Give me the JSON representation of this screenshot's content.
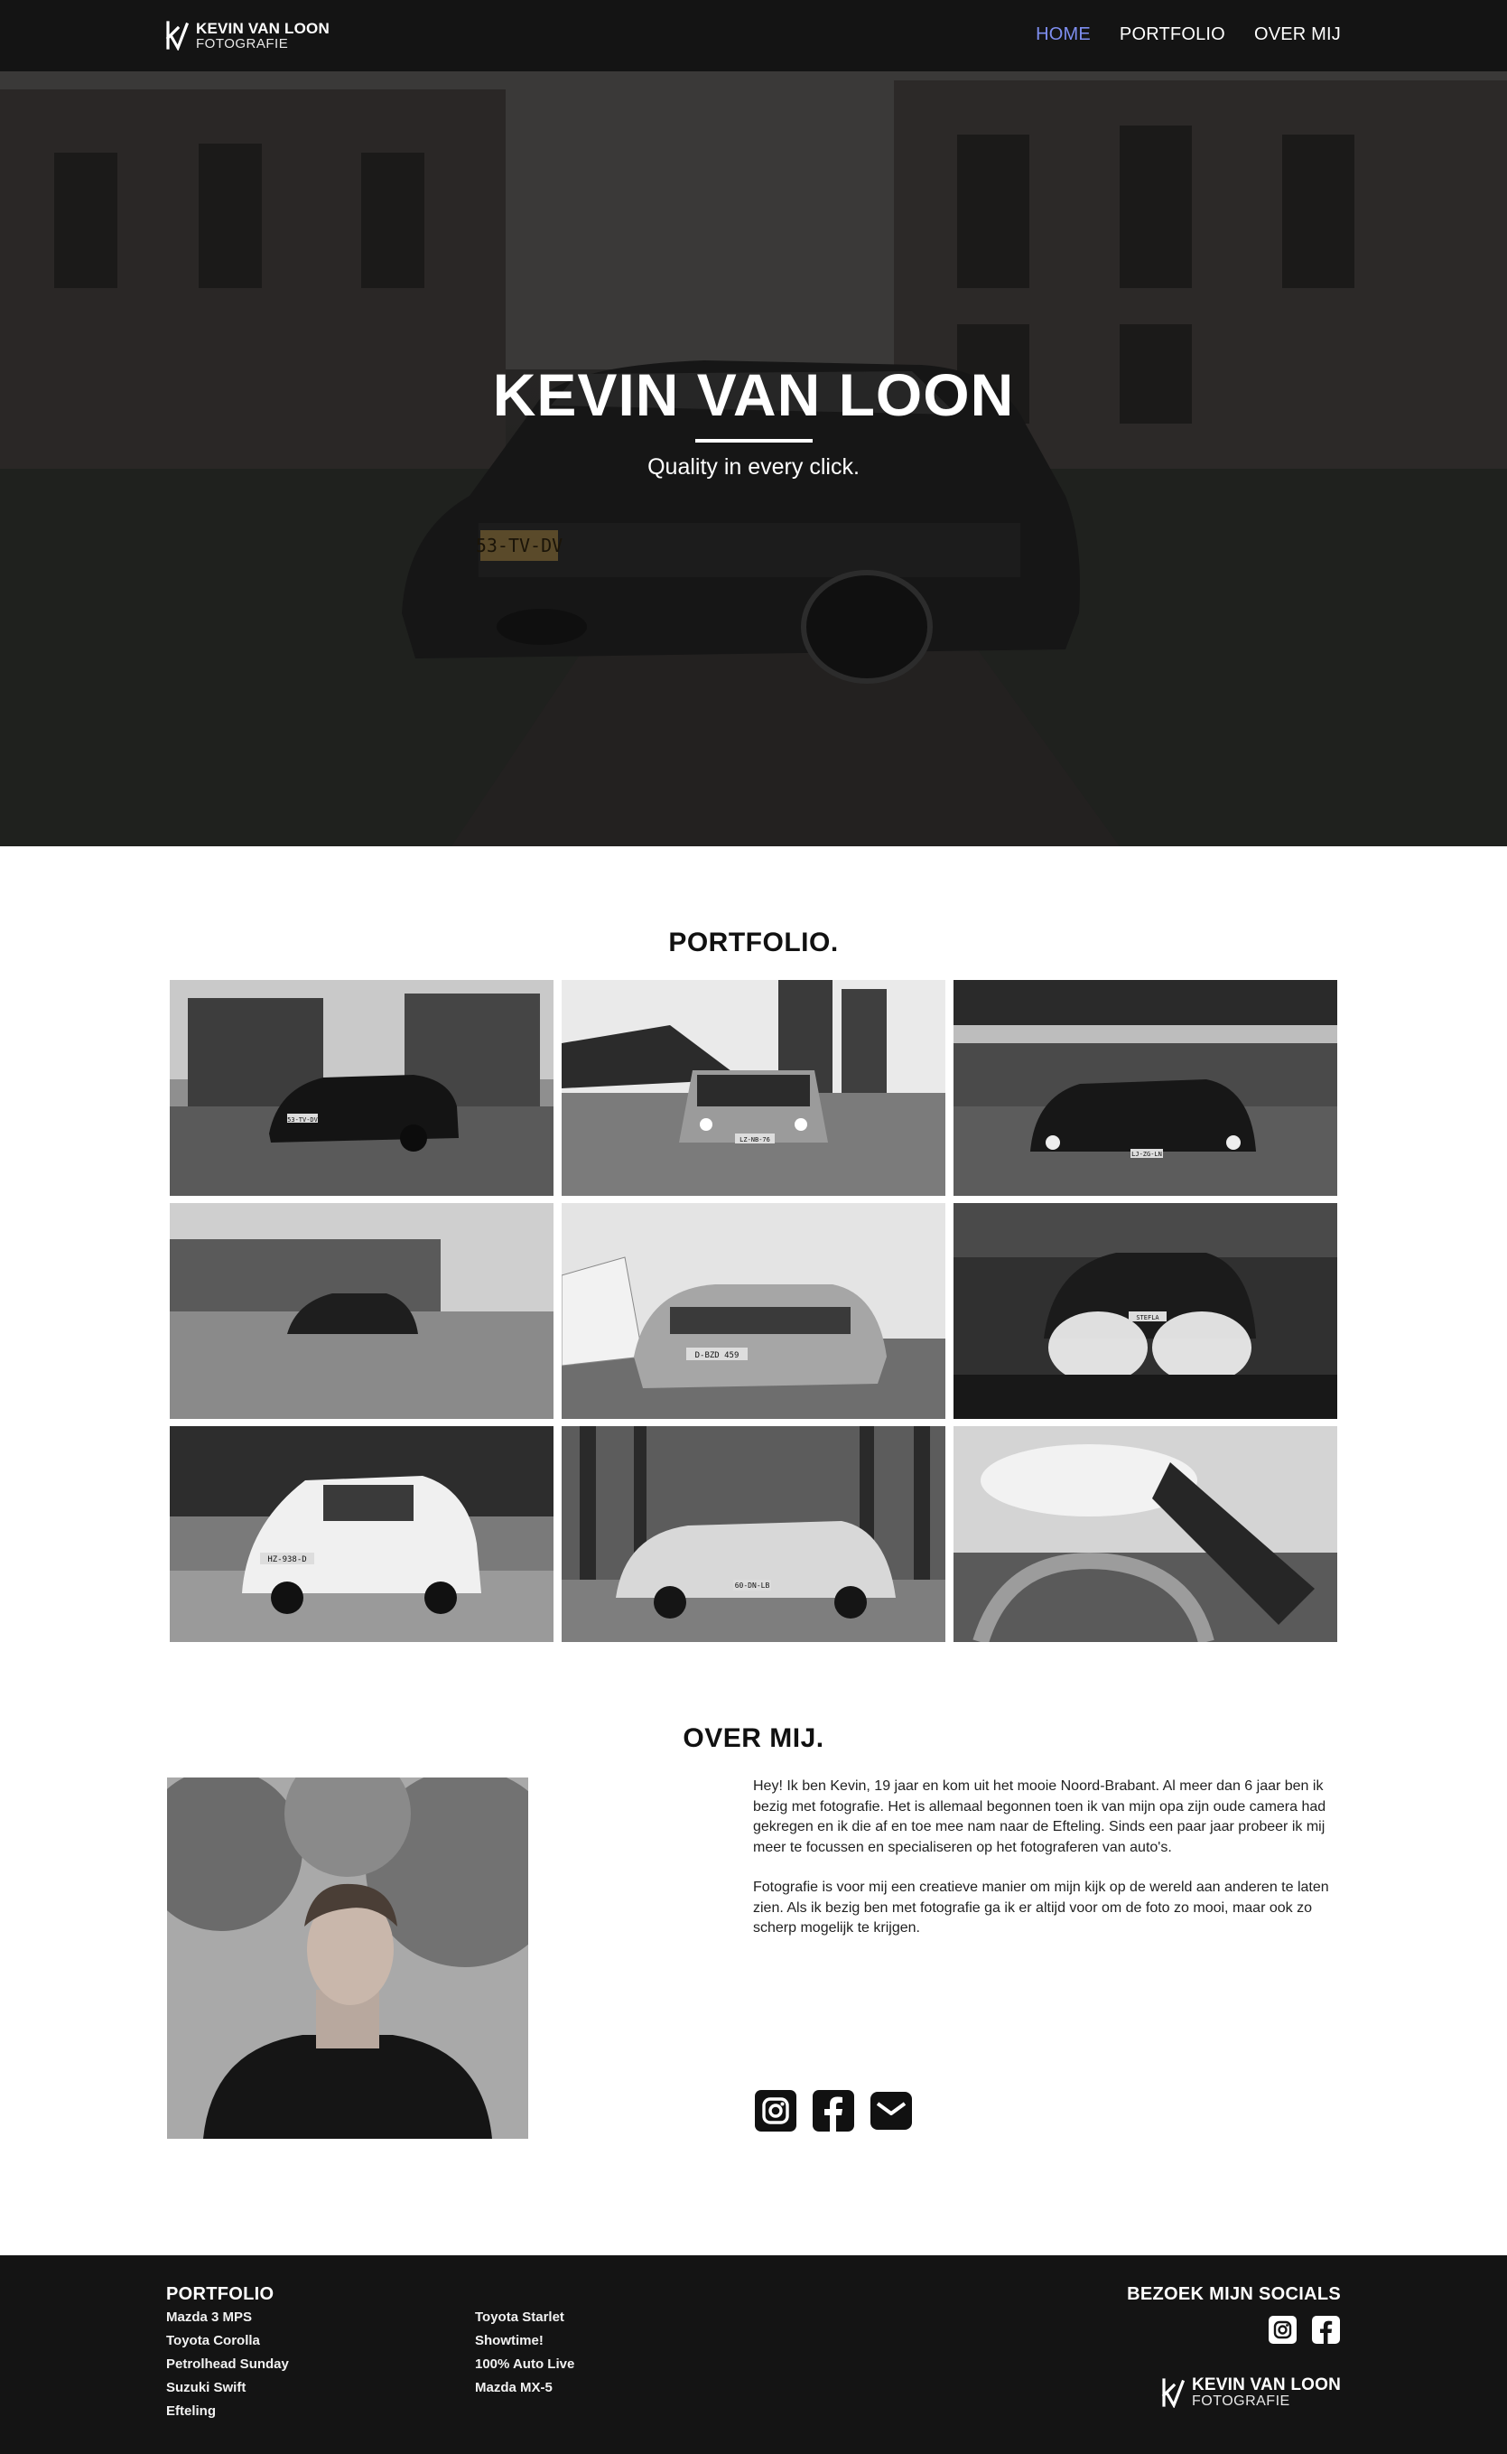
{
  "header": {
    "logo_name": "KEVIN VAN LOON",
    "logo_sub": "FOTOGRAFIE",
    "nav": [
      {
        "label": "HOME",
        "active": true
      },
      {
        "label": "PORTFOLIO",
        "active": false
      },
      {
        "label": "OVER MIJ",
        "active": false
      }
    ]
  },
  "hero": {
    "title": "KEVIN VAN LOON",
    "tagline": "Quality in every click.",
    "plate": "53-TV-DV"
  },
  "portfolio": {
    "title": "PORTFOLIO.",
    "photos": [
      {
        "name": "Mazda 3 MPS",
        "plate": "53-TV-DV"
      },
      {
        "name": "Toyota Starlet",
        "plate": "LZ-NB-76"
      },
      {
        "name": "Toyota Corolla",
        "plate": "LJ-ZG-LN"
      },
      {
        "name": "Showtime!",
        "plate": ""
      },
      {
        "name": "Petrolhead Sunday",
        "plate": "D-BZD 459"
      },
      {
        "name": "100% Auto Live",
        "plate": "STEFLA"
      },
      {
        "name": "Suzuki Swift",
        "plate": "HZ-938-D"
      },
      {
        "name": "Mazda MX-5",
        "plate": "60-DN-LB"
      },
      {
        "name": "Efteling",
        "plate": ""
      }
    ]
  },
  "about": {
    "title": "OVER MIJ.",
    "paragraphs": [
      "Hey! Ik ben Kevin, 19 jaar en kom uit het mooie Noord-Brabant. Al meer dan 6 jaar ben ik bezig met fotografie. Het is allemaal begonnen toen ik van mijn opa zijn oude camera had gekregen en ik die af en toe mee nam naar de Efteling. Sinds een paar jaar probeer ik mij meer te focussen en specialiseren op het fotograferen van auto's.",
      "Fotografie is voor mij een creatieve manier om mijn kijk op de wereld aan anderen te laten zien. Als ik bezig ben met fotografie ga ik er altijd voor om de foto zo mooi, maar ook zo scherp mogelijk te krijgen."
    ],
    "socials": [
      "instagram-icon",
      "facebook-icon",
      "mail-icon"
    ]
  },
  "footer": {
    "portfolio_heading": "PORTFOLIO",
    "col1": [
      "Mazda 3 MPS",
      "Toyota Corolla",
      "Petrolhead Sunday",
      "Suzuki Swift",
      "Efteling"
    ],
    "col2": [
      "Toyota Starlet",
      "Showtime!",
      "100% Auto Live",
      "Mazda MX-5"
    ],
    "socials_heading": "BEZOEK MIJN SOCIALS",
    "logo_name": "KEVIN VAN LOON",
    "logo_sub": "FOTOGRAFIE"
  },
  "colors": {
    "nav_bg": "#141414",
    "accent": "#7e8ef0",
    "footer_bg": "#141414"
  }
}
